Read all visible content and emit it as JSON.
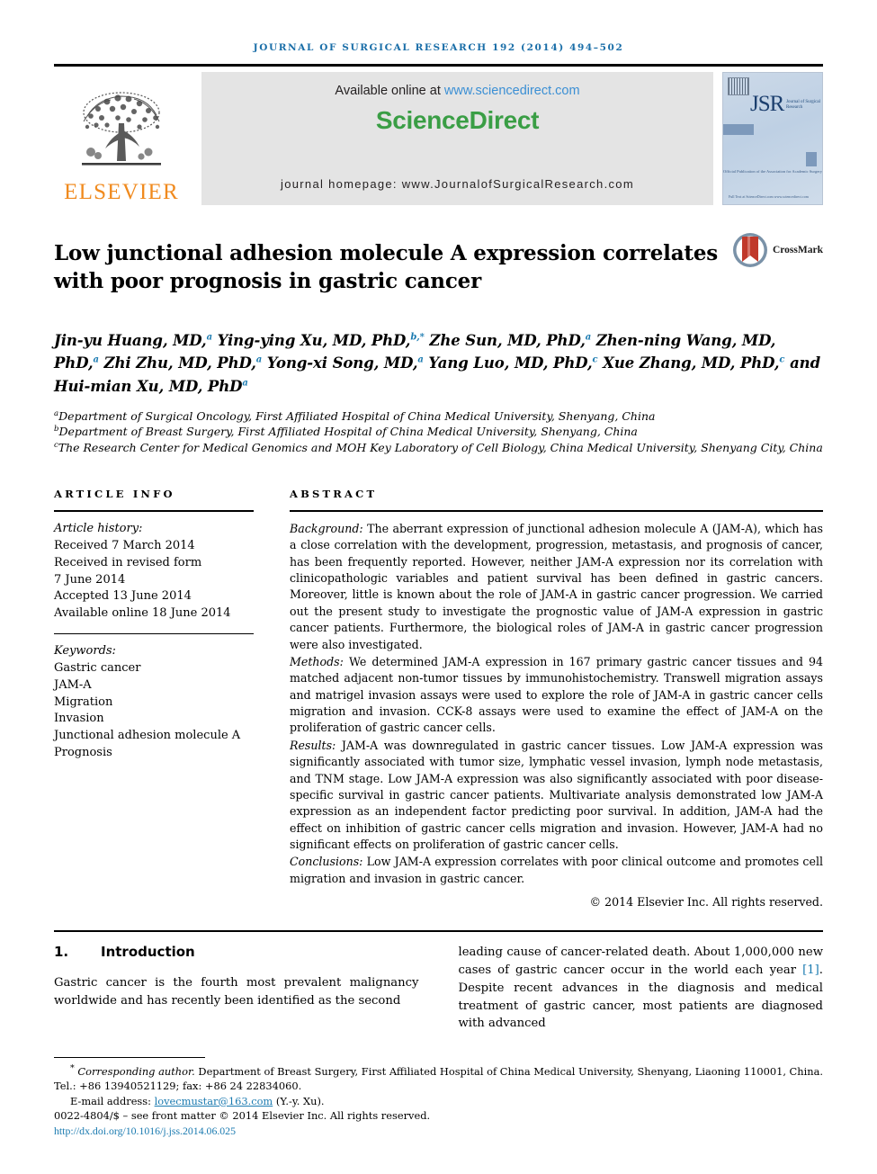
{
  "running_head": "Journal of Surgical Research 192 (2014) 494–502",
  "masthead": {
    "elsevier_wordmark": "ELSEVIER",
    "elsevier_logo_icon": "elsevier-tree-icon",
    "available_prefix": "Available online at ",
    "sciencedirect_url": "www.sciencedirect.com",
    "sciencedirect_logo": "ScienceDirect",
    "journal_homepage": "journal homepage: www.JournalofSurgicalResearch.com",
    "cover": {
      "acronym": "JSR",
      "subtitle": "Journal of Surgical Research",
      "tagline": "Official Publication of the Association for Academic Surgery",
      "footline": "Full Text at ScienceDirect.com\nwww.sciencedirect.com"
    }
  },
  "article": {
    "title": "Low junctional adhesion molecule A expression correlates with poor prognosis in gastric cancer",
    "crossmark_label": "CrossMark",
    "crossmark_icon": "crossmark-icon",
    "authors_line_1": "Jin-yu Huang, MD,",
    "authors": [
      {
        "name": "Jin-yu Huang, MD,",
        "sup": "a"
      },
      {
        "name": "Ying-ying Xu, MD, PhD,",
        "sup": "b,*"
      },
      {
        "name": "Zhe Sun, MD, PhD,",
        "sup": "a"
      },
      {
        "name": "Zhen-ning Wang, MD, PhD,",
        "sup": "a"
      },
      {
        "name": "Zhi Zhu, MD, PhD,",
        "sup": "a"
      },
      {
        "name": "Yong-xi Song, MD,",
        "sup": "a"
      },
      {
        "name": "Yang Luo, MD, PhD,",
        "sup": "c"
      },
      {
        "name": "Xue Zhang, MD, PhD,",
        "sup": "c"
      },
      {
        "name": "and Hui-mian Xu, MD, PhD",
        "sup": "a"
      }
    ],
    "affiliations": [
      {
        "sup": "a",
        "text": "Department of Surgical Oncology, First Affiliated Hospital of China Medical University, Shenyang, China"
      },
      {
        "sup": "b",
        "text": "Department of Breast Surgery, First Affiliated Hospital of China Medical University, Shenyang, China"
      },
      {
        "sup": "c",
        "text": "The Research Center for Medical Genomics and MOH Key Laboratory of Cell Biology, China Medical University, Shenyang City, China"
      }
    ]
  },
  "article_info": {
    "heading": "ARTICLE INFO",
    "history_label": "Article history:",
    "history": [
      "Received 7 March 2014",
      "Received in revised form",
      "7 June 2014",
      "Accepted 13 June 2014",
      "Available online 18 June 2014"
    ],
    "keywords_label": "Keywords:",
    "keywords": [
      "Gastric cancer",
      "JAM-A",
      "Migration",
      "Invasion",
      "Junctional adhesion molecule A",
      "Prognosis"
    ]
  },
  "abstract": {
    "heading": "ABSTRACT",
    "sections": [
      {
        "label": "Background:",
        "text": " The aberrant expression of junctional adhesion molecule A (JAM-A), which has a close correlation with the development, progression, metastasis, and prognosis of cancer, has been frequently reported. However, neither JAM-A expression nor its correlation with clinicopathologic variables and patient survival has been defined in gastric cancers. Moreover, little is known about the role of JAM-A in gastric cancer progression. We carried out the present study to investigate the prognostic value of JAM-A expression in gastric cancer patients. Furthermore, the biological roles of JAM-A in gastric cancer progression were also investigated."
      },
      {
        "label": "Methods:",
        "text": " We determined JAM-A expression in 167 primary gastric cancer tissues and 94 matched adjacent non-tumor tissues by immunohistochemistry. Transwell migration assays and matrigel invasion assays were used to explore the role of JAM-A in gastric cancer cells migration and invasion. CCK-8 assays were used to examine the effect of JAM-A on the proliferation of gastric cancer cells."
      },
      {
        "label": "Results:",
        "text": " JAM-A was downregulated in gastric cancer tissues. Low JAM-A expression was significantly associated with tumor size, lymphatic vessel invasion, lymph node metastasis, and TNM stage. Low JAM-A expression was also significantly associated with poor disease-specific survival in gastric cancer patients. Multivariate analysis demonstrated low JAM-A expression as an independent factor predicting poor survival. In addition, JAM-A had the effect on inhibition of gastric cancer cells migration and invasion. However, JAM-A had no significant effects on proliferation of gastric cancer cells."
      },
      {
        "label": "Conclusions:",
        "text": " Low JAM-A expression correlates with poor clinical outcome and promotes cell migration and invasion in gastric cancer."
      }
    ],
    "copyright": "© 2014 Elsevier Inc. All rights reserved."
  },
  "introduction": {
    "number": "1.",
    "heading": "Introduction",
    "left_paragraph": "Gastric cancer is the fourth most prevalent malignancy worldwide and has recently been identified as the second",
    "right_paragraph_part1": "leading cause of cancer-related death. About 1,000,000 new cases of gastric cancer occur in the world each year ",
    "right_reference": "[1]",
    "right_paragraph_part2": ". Despite recent advances in the diagnosis and medical treatment of gastric cancer, most patients are diagnosed with advanced"
  },
  "footnotes": {
    "corresponding_marker": "*",
    "corresponding_label": "Corresponding author.",
    "corresponding_text": " Department of Breast Surgery, First Affiliated Hospital of China Medical University, Shenyang, Liaoning 110001, China. Tel.: +86 13940521129; fax: +86 24 22834060.",
    "email_label": "E-mail address: ",
    "email": "lovecmustar@163.com",
    "email_suffix": " (Y.-y. Xu).",
    "issn_line": "0022-4804/$ – see front matter © 2014 Elsevier Inc. All rights reserved.",
    "doi": "http://dx.doi.org/10.1016/j.jss.2014.06.025"
  },
  "colors": {
    "header_blue": "#1a6ea8",
    "link_blue": "#1a7ab0",
    "sciencedirect_green": "#3a9e45",
    "elsevier_orange": "#f08a1e",
    "sd_url_blue": "#3b8fd4"
  }
}
